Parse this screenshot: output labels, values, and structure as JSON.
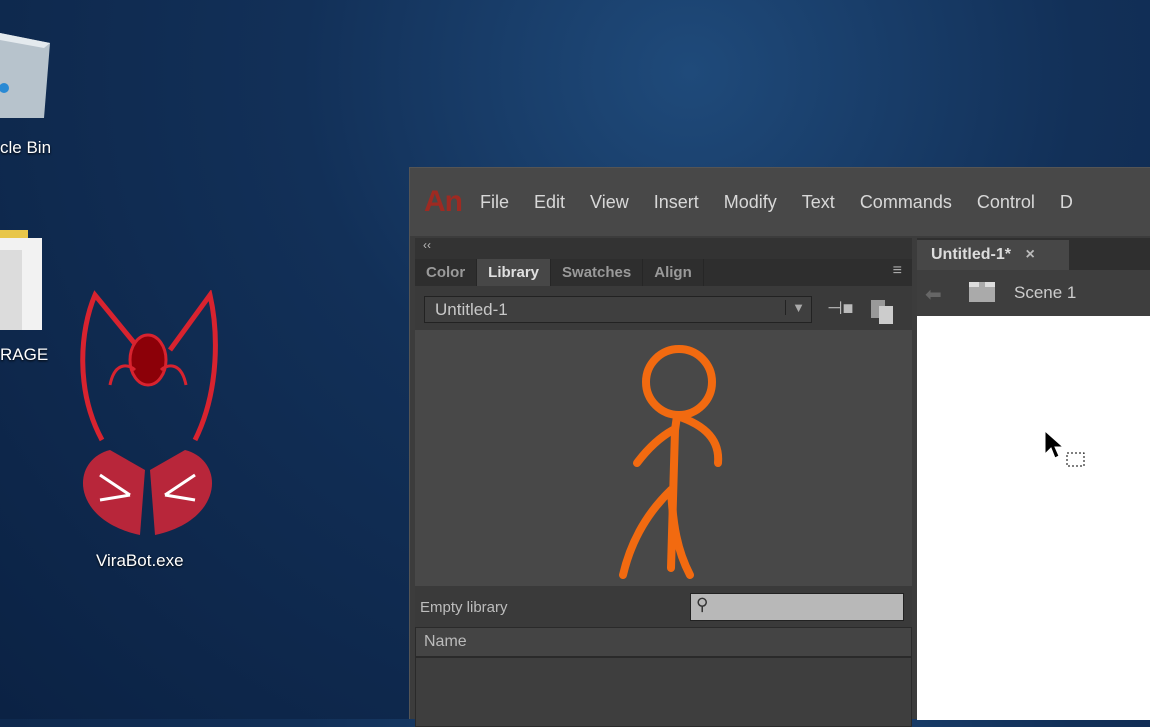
{
  "desktop": {
    "icons": [
      {
        "label": "cle Bin",
        "icon": "recycle-bin-icon"
      },
      {
        "label": "RAGE",
        "icon": "folder-icon"
      },
      {
        "label": "ViraBot.exe",
        "icon": "virabot-icon"
      }
    ]
  },
  "app": {
    "logo": "An",
    "menu": [
      "File",
      "Edit",
      "View",
      "Insert",
      "Modify",
      "Text",
      "Commands",
      "Control",
      "D"
    ]
  },
  "panel": {
    "collapse": "‹‹",
    "tabs": [
      "Color",
      "Library",
      "Swatches",
      "Align"
    ],
    "active_tab": "Library",
    "document_select": "Untitled-1",
    "status": "Empty library",
    "search_placeholder": "",
    "name_header": "Name"
  },
  "document": {
    "tab_label": "Untitled-1*",
    "close": "×",
    "scene": "Scene 1"
  },
  "colors": {
    "accent": "#f26a10",
    "logo": "#9e2a22"
  }
}
